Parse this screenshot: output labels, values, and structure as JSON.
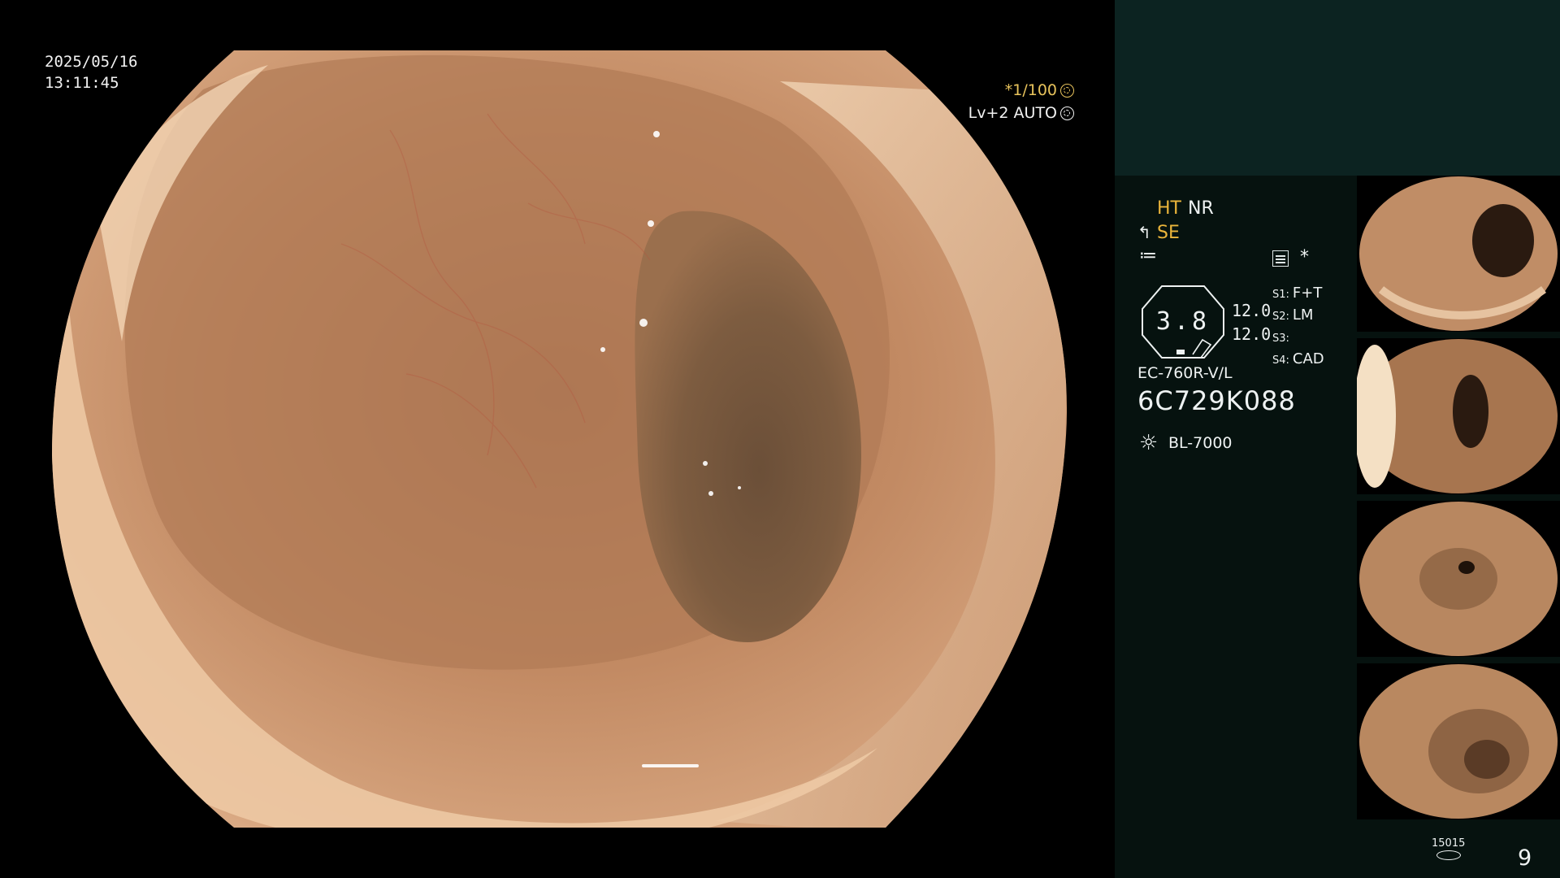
{
  "overlay": {
    "date": "2025/05/16",
    "time": "13:11:45",
    "shutter": "*1/100",
    "iris": "Lv+2 AUTO"
  },
  "status": {
    "ht": "HT",
    "nr": "NR",
    "se": "SE",
    "zoom": "3.8",
    "value_top": "12.0",
    "value_bottom": "12.0",
    "s1": {
      "key": "S1:",
      "val": "F+T"
    },
    "s2": {
      "key": "S2:",
      "val": "LM"
    },
    "s3": {
      "key": "S3:",
      "val": ""
    },
    "s4": {
      "key": "S4:",
      "val": "CAD"
    },
    "asterisk": "*",
    "scope_model": "EC-760R-V/L",
    "scope_serial": "6C729K088",
    "light_source": "BL-7000"
  },
  "capture": {
    "count_label": "15015",
    "image_count": "9"
  },
  "colors": {
    "amber": "#ebb53b",
    "panel_top": "#0c2321",
    "panel_bg": "#06120f",
    "tissue": "#c89068"
  },
  "icons": [
    "shutter-icon",
    "iris-icon",
    "structure-enhance-icon",
    "color-enhance-icon",
    "menu-icon",
    "light-source-icon",
    "capture-count-icon"
  ]
}
